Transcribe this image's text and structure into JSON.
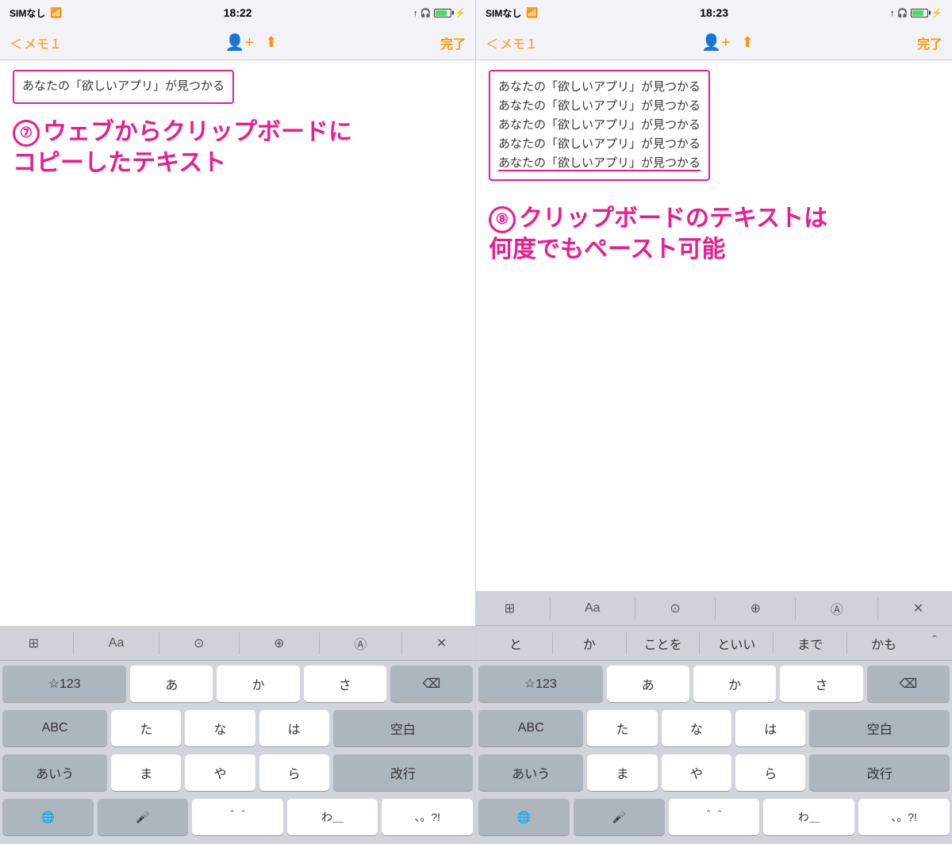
{
  "screens": [
    {
      "id": "left",
      "status": {
        "left": "SIMなし 🛜",
        "time": "18:22",
        "right": "🎧 ⚡"
      },
      "nav": {
        "back": "＜ メモ１",
        "done": "完了"
      },
      "content": {
        "text_box": "あなたの「欲しいアプリ」が見つかる",
        "annotation_number": "⑦",
        "annotation_text": "ウェブからクリップボードに\nコピーしたテキスト"
      },
      "toolbar": {
        "items": [
          "⊞",
          "Aa",
          "⊙",
          "⊕",
          "Ⓐ",
          "×"
        ]
      },
      "suggestions_visible": false,
      "keyboard": {
        "row1": [
          "☆123",
          "あ",
          "か",
          "さ",
          "⌫"
        ],
        "row2": [
          "ABC",
          "た",
          "な",
          "は",
          "空白"
        ],
        "row3": [
          "あいう",
          "ま",
          "や",
          "ら",
          "改行"
        ],
        "row_bottom": [
          "🌐",
          "🎤",
          "＾＾",
          "わ＿",
          "、。?!"
        ]
      }
    },
    {
      "id": "right",
      "status": {
        "left": "SIMなし 🛜",
        "time": "18:23",
        "right": "🎧 ⚡"
      },
      "nav": {
        "back": "＜ メモ１",
        "done": "完了"
      },
      "content": {
        "text_lines": [
          "あなたの「欲しいアプリ」が見つかる",
          "あなたの「欲しいアプリ」が見つかる",
          "あなたの「欲しいアプリ」が見つかる",
          "あなたの「欲しいアプリ」が見つかる",
          "あなたの「欲しいアプリ」が見つかる"
        ],
        "annotation_number": "⑧",
        "annotation_text": "クリップボードのテキストは\n何度でもペースト可能"
      },
      "toolbar": {
        "items": [
          "⊞",
          "Aa",
          "⊙",
          "⊕",
          "Ⓐ",
          "×"
        ]
      },
      "suggestions": [
        "と",
        "か",
        "ことを",
        "といい",
        "まで",
        "かも"
      ],
      "keyboard": {
        "row1": [
          "☆123",
          "あ",
          "か",
          "さ",
          "⌫"
        ],
        "row2": [
          "ABC",
          "た",
          "な",
          "は",
          "空白"
        ],
        "row3": [
          "あいう",
          "ま",
          "や",
          "ら",
          "改行"
        ],
        "row_bottom": [
          "🌐",
          "🎤",
          "＾＾",
          "わ＿",
          "、。?!"
        ]
      }
    }
  ]
}
